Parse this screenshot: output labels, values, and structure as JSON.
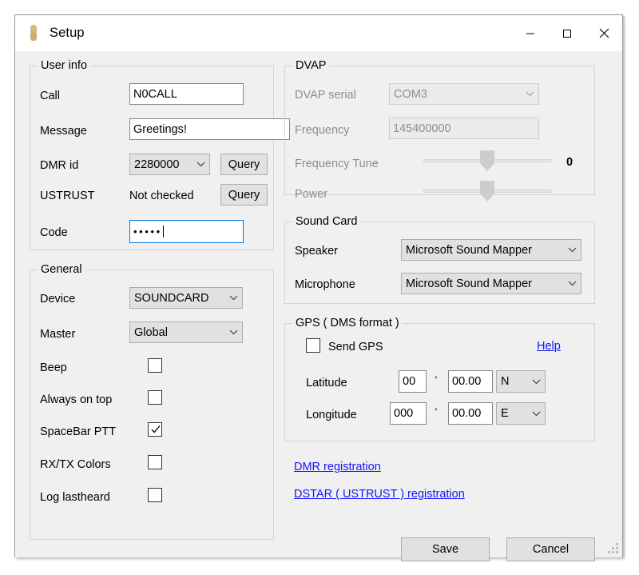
{
  "window": {
    "title": "Setup",
    "icon": "microphone-icon",
    "minimize_label": "–",
    "maximize_label": "□",
    "close_label": "✕"
  },
  "user_info": {
    "legend": "User info",
    "call_label": "Call",
    "call_value": "N0CALL",
    "message_label": "Message",
    "message_value": "Greetings!",
    "dmr_id_label": "DMR id",
    "dmr_id_value": "2280000",
    "dmr_query_label": "Query",
    "ustrust_label": "USTRUST",
    "ustrust_status": "Not checked",
    "ustrust_query_label": "Query",
    "code_label": "Code",
    "code_value": "•••••"
  },
  "general": {
    "legend": "General",
    "device_label": "Device",
    "device_value": "SOUNDCARD",
    "master_label": "Master",
    "master_value": "Global",
    "checkboxes": [
      {
        "label": "Beep",
        "checked": false
      },
      {
        "label": "Always on top",
        "checked": false
      },
      {
        "label": "SpaceBar PTT",
        "checked": true
      },
      {
        "label": "RX/TX Colors",
        "checked": false
      },
      {
        "label": "Log lastheard",
        "checked": false
      }
    ]
  },
  "dvap": {
    "legend": "DVAP",
    "serial_label": "DVAP serial",
    "serial_value": "COM3",
    "frequency_label": "Frequency",
    "frequency_value": "145400000",
    "freq_tune_label": "Frequency Tune",
    "freq_tune_value": "0",
    "power_label": "Power"
  },
  "sound_card": {
    "legend": "Sound Card",
    "speaker_label": "Speaker",
    "speaker_value": "Microsoft Sound Mapper",
    "microphone_label": "Microphone",
    "microphone_value": "Microsoft Sound Mapper"
  },
  "gps": {
    "legend": "GPS ( DMS format )",
    "send_gps_label": "Send GPS",
    "send_gps_checked": false,
    "help_label": "Help",
    "latitude_label": "Latitude",
    "latitude_deg": "00",
    "latitude_min": "00.00",
    "latitude_dir": "N",
    "longitude_label": "Longitude",
    "longitude_deg": "000",
    "longitude_min": "00.00",
    "longitude_dir": "E",
    "degree_symbol": "°"
  },
  "links": {
    "dmr_registration": "DMR registration",
    "dstar_registration": "DSTAR ( USTRUST ) registration"
  },
  "actions": {
    "save_label": "Save",
    "cancel_label": "Cancel"
  },
  "colors": {
    "link": "#1414ff",
    "focus_border": "#0078d7",
    "window_bg": "#f0f0f0"
  }
}
